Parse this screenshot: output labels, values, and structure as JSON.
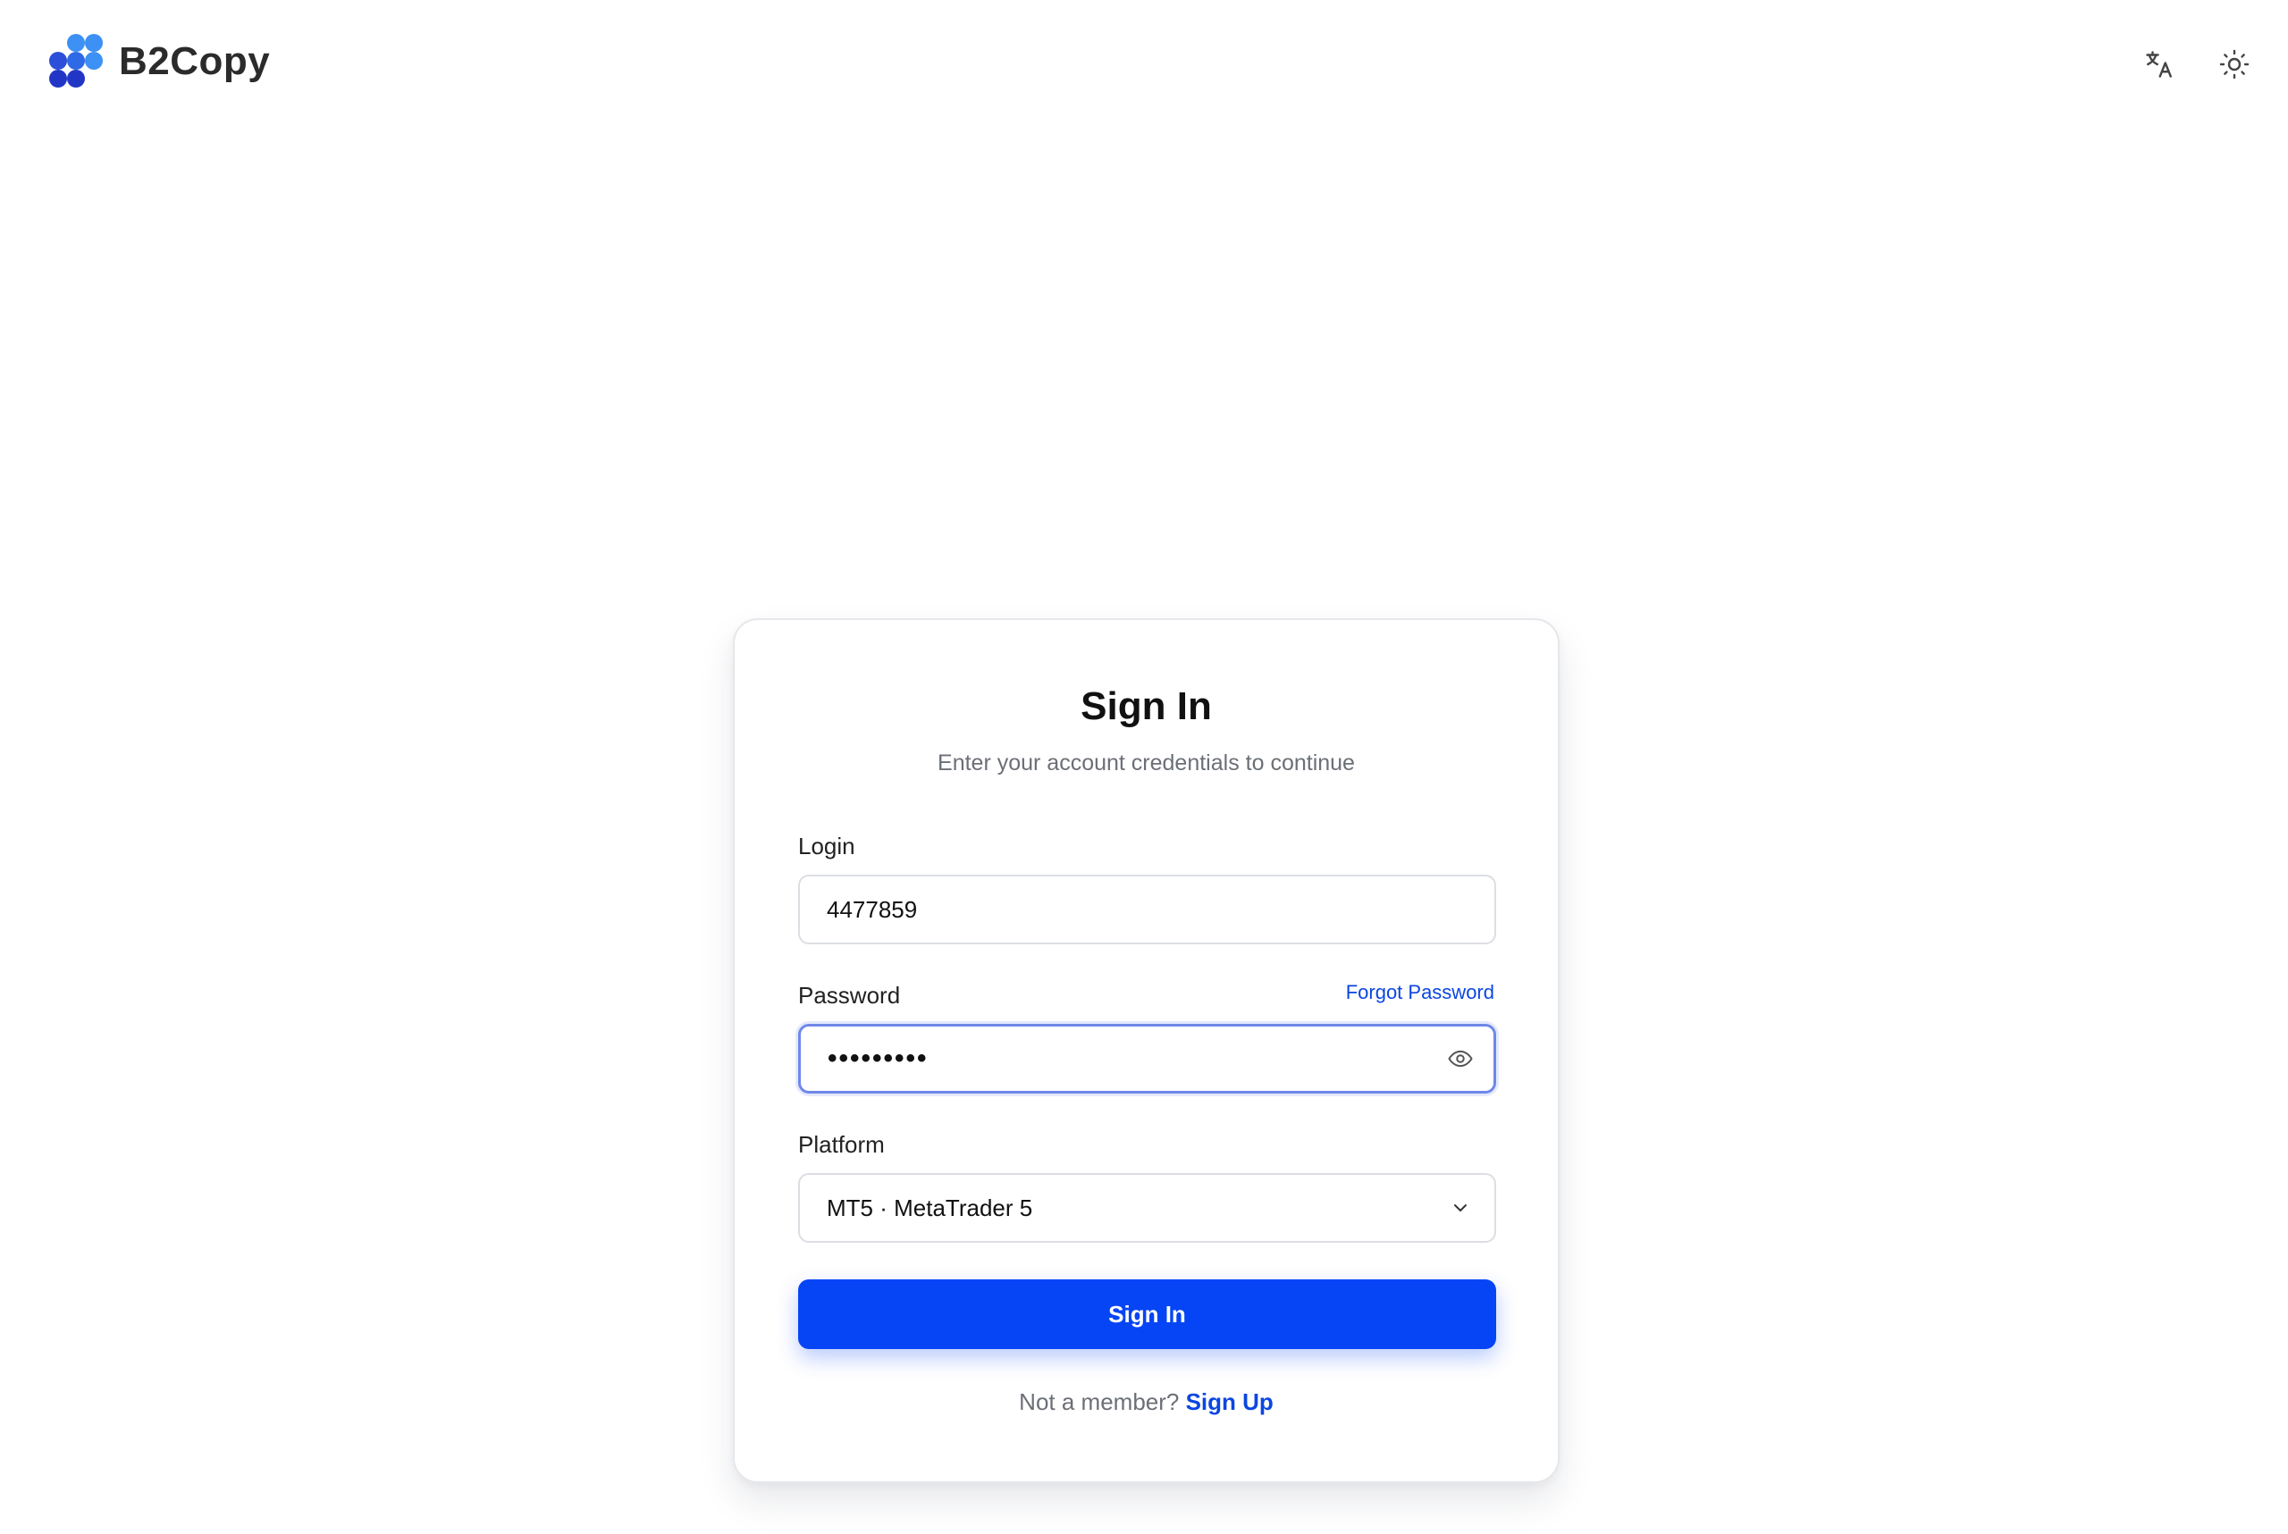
{
  "header": {
    "brand_name": "B2Copy",
    "logo_icon": "b2copy-dots-logo",
    "translate_icon": "translate-icon",
    "theme_icon": "sun-icon"
  },
  "signin": {
    "title": "Sign In",
    "subtitle": "Enter your account credentials to continue",
    "login": {
      "label": "Login",
      "value": "4477859"
    },
    "password": {
      "label": "Password",
      "value_masked": "•••••••••",
      "forgot_link": "Forgot Password",
      "toggle_icon": "eye-icon"
    },
    "platform": {
      "label": "Platform",
      "selected": "MT5 · MetaTrader 5",
      "chevron_icon": "chevron-down-icon"
    },
    "submit_label": "Sign In",
    "footer": {
      "prompt": "Not a member?",
      "link": "Sign Up"
    }
  },
  "colors": {
    "accent": "#0545f5",
    "link": "#0b46e0",
    "focus_border": "#6f88e8",
    "logo_light": "#3b8cf2",
    "logo_dark": "#2336c8"
  }
}
